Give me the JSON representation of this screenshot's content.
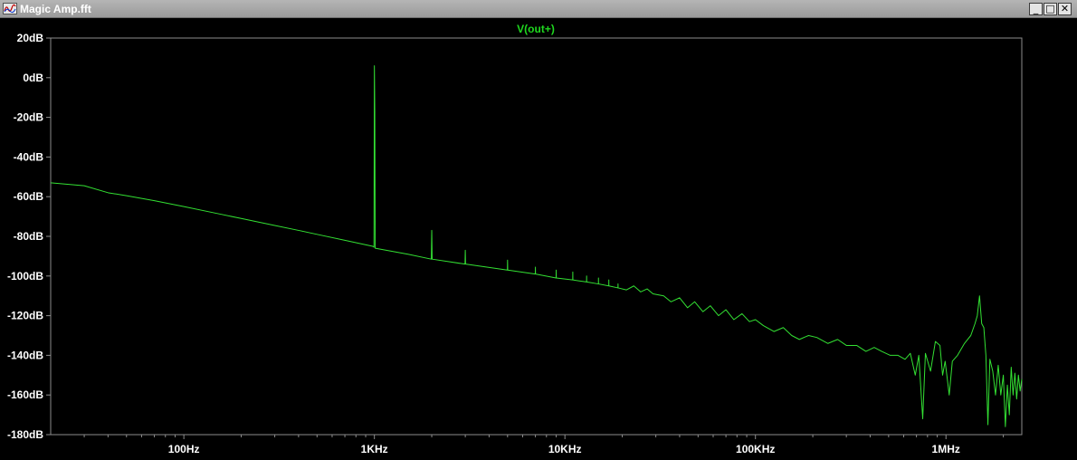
{
  "window": {
    "title": "Magic Amp.fft",
    "minimize_glyph": "_",
    "maximize_glyph": "□",
    "close_glyph": "✕"
  },
  "colors": {
    "background": "#000000",
    "frame": "#8c8c8c",
    "trace": "#33e033",
    "series_label": "#1fd81f",
    "titlebar": "#a8a8a8",
    "text": "#ffffff"
  },
  "chart_data": {
    "type": "line",
    "title": "",
    "xlabel": "",
    "ylabel": "",
    "x_scale": "log",
    "xlim": [
      20,
      2500000
    ],
    "ylim": [
      -180,
      20
    ],
    "grid": false,
    "legend": "top-center",
    "xticks": [
      {
        "value": 100,
        "label": "100Hz"
      },
      {
        "value": 1000,
        "label": "1KHz"
      },
      {
        "value": 10000,
        "label": "10KHz"
      },
      {
        "value": 100000,
        "label": "100KHz"
      },
      {
        "value": 1000000,
        "label": "1MHz"
      }
    ],
    "yticks": [
      {
        "value": 20,
        "label": "20dB"
      },
      {
        "value": 0,
        "label": "0dB"
      },
      {
        "value": -20,
        "label": "-20dB"
      },
      {
        "value": -40,
        "label": "-40dB"
      },
      {
        "value": -60,
        "label": "-60dB"
      },
      {
        "value": -80,
        "label": "-80dB"
      },
      {
        "value": -100,
        "label": "-100dB"
      },
      {
        "value": -120,
        "label": "-120dB"
      },
      {
        "value": -140,
        "label": "-140dB"
      },
      {
        "value": -160,
        "label": "-160dB"
      },
      {
        "value": -180,
        "label": "-180dB"
      }
    ],
    "series": [
      {
        "name": "V(out+)",
        "color": "#33e033",
        "points": [
          [
            20,
            -53
          ],
          [
            30,
            -54.5
          ],
          [
            40,
            -58
          ],
          [
            50,
            -59.5
          ],
          [
            70,
            -62
          ],
          [
            100,
            -65
          ],
          [
            150,
            -68.5
          ],
          [
            200,
            -71
          ],
          [
            300,
            -74.5
          ],
          [
            400,
            -77
          ],
          [
            500,
            -79
          ],
          [
            700,
            -82
          ],
          [
            980,
            -85
          ],
          [
            995,
            -85.5
          ],
          [
            1000,
            6
          ],
          [
            1005,
            -17
          ],
          [
            1010,
            -86
          ],
          [
            1500,
            -89
          ],
          [
            1990,
            -91.5
          ],
          [
            2000,
            -77
          ],
          [
            2010,
            -91.5
          ],
          [
            2990,
            -94
          ],
          [
            3000,
            -87
          ],
          [
            3010,
            -94
          ],
          [
            4990,
            -97
          ],
          [
            5000,
            -92
          ],
          [
            5010,
            -97
          ],
          [
            6990,
            -99
          ],
          [
            7000,
            -95.5
          ],
          [
            7010,
            -99
          ],
          [
            8990,
            -101
          ],
          [
            9000,
            -97
          ],
          [
            9010,
            -101
          ],
          [
            10990,
            -102
          ],
          [
            11000,
            -98
          ],
          [
            11010,
            -102
          ],
          [
            12990,
            -103
          ],
          [
            13000,
            -100
          ],
          [
            13010,
            -103
          ],
          [
            14990,
            -104
          ],
          [
            15000,
            -101
          ],
          [
            15010,
            -104
          ],
          [
            16990,
            -105
          ],
          [
            17000,
            -102
          ],
          [
            17010,
            -105
          ],
          [
            18990,
            -106
          ],
          [
            19000,
            -104
          ],
          [
            19010,
            -106
          ],
          [
            21000,
            -107
          ],
          [
            23000,
            -105
          ],
          [
            25000,
            -108
          ],
          [
            27000,
            -106.5
          ],
          [
            29000,
            -109
          ],
          [
            33000,
            -110
          ],
          [
            36000,
            -113
          ],
          [
            40000,
            -111
          ],
          [
            44000,
            -116
          ],
          [
            48000,
            -113
          ],
          [
            53000,
            -118
          ],
          [
            58000,
            -115
          ],
          [
            64000,
            -120
          ],
          [
            70000,
            -117
          ],
          [
            77000,
            -122
          ],
          [
            85000,
            -119
          ],
          [
            93000,
            -123
          ],
          [
            100000,
            -122
          ],
          [
            110000,
            -125
          ],
          [
            125000,
            -128
          ],
          [
            140000,
            -126
          ],
          [
            155000,
            -130
          ],
          [
            170000,
            -132
          ],
          [
            190000,
            -130
          ],
          [
            210000,
            -131
          ],
          [
            240000,
            -134
          ],
          [
            270000,
            -132
          ],
          [
            300000,
            -135
          ],
          [
            340000,
            -135
          ],
          [
            380000,
            -138
          ],
          [
            420000,
            -136
          ],
          [
            460000,
            -138
          ],
          [
            510000,
            -140
          ],
          [
            560000,
            -140
          ],
          [
            610000,
            -142
          ],
          [
            650000,
            -139
          ],
          [
            690000,
            -150
          ],
          [
            720000,
            -140
          ],
          [
            755000,
            -172
          ],
          [
            780000,
            -139
          ],
          [
            830000,
            -148
          ],
          [
            880000,
            -133
          ],
          [
            930000,
            -135
          ],
          [
            960000,
            -150
          ],
          [
            990000,
            -143
          ],
          [
            1040000,
            -160
          ],
          [
            1080000,
            -143
          ],
          [
            1150000,
            -140
          ],
          [
            1250000,
            -134
          ],
          [
            1350000,
            -130
          ],
          [
            1420000,
            -124
          ],
          [
            1460000,
            -120
          ],
          [
            1500000,
            -110
          ],
          [
            1540000,
            -124
          ],
          [
            1580000,
            -126
          ],
          [
            1620000,
            -140
          ],
          [
            1660000,
            -175
          ],
          [
            1700000,
            -142
          ],
          [
            1760000,
            -148
          ],
          [
            1820000,
            -160
          ],
          [
            1880000,
            -145
          ],
          [
            1940000,
            -160
          ],
          [
            2000000,
            -150
          ],
          [
            2050000,
            -176
          ],
          [
            2100000,
            -155
          ],
          [
            2150000,
            -170
          ],
          [
            2200000,
            -146
          ],
          [
            2250000,
            -160
          ],
          [
            2300000,
            -149
          ],
          [
            2350000,
            -162
          ],
          [
            2400000,
            -150
          ],
          [
            2450000,
            -158
          ],
          [
            2500000,
            -152
          ]
        ]
      }
    ]
  }
}
